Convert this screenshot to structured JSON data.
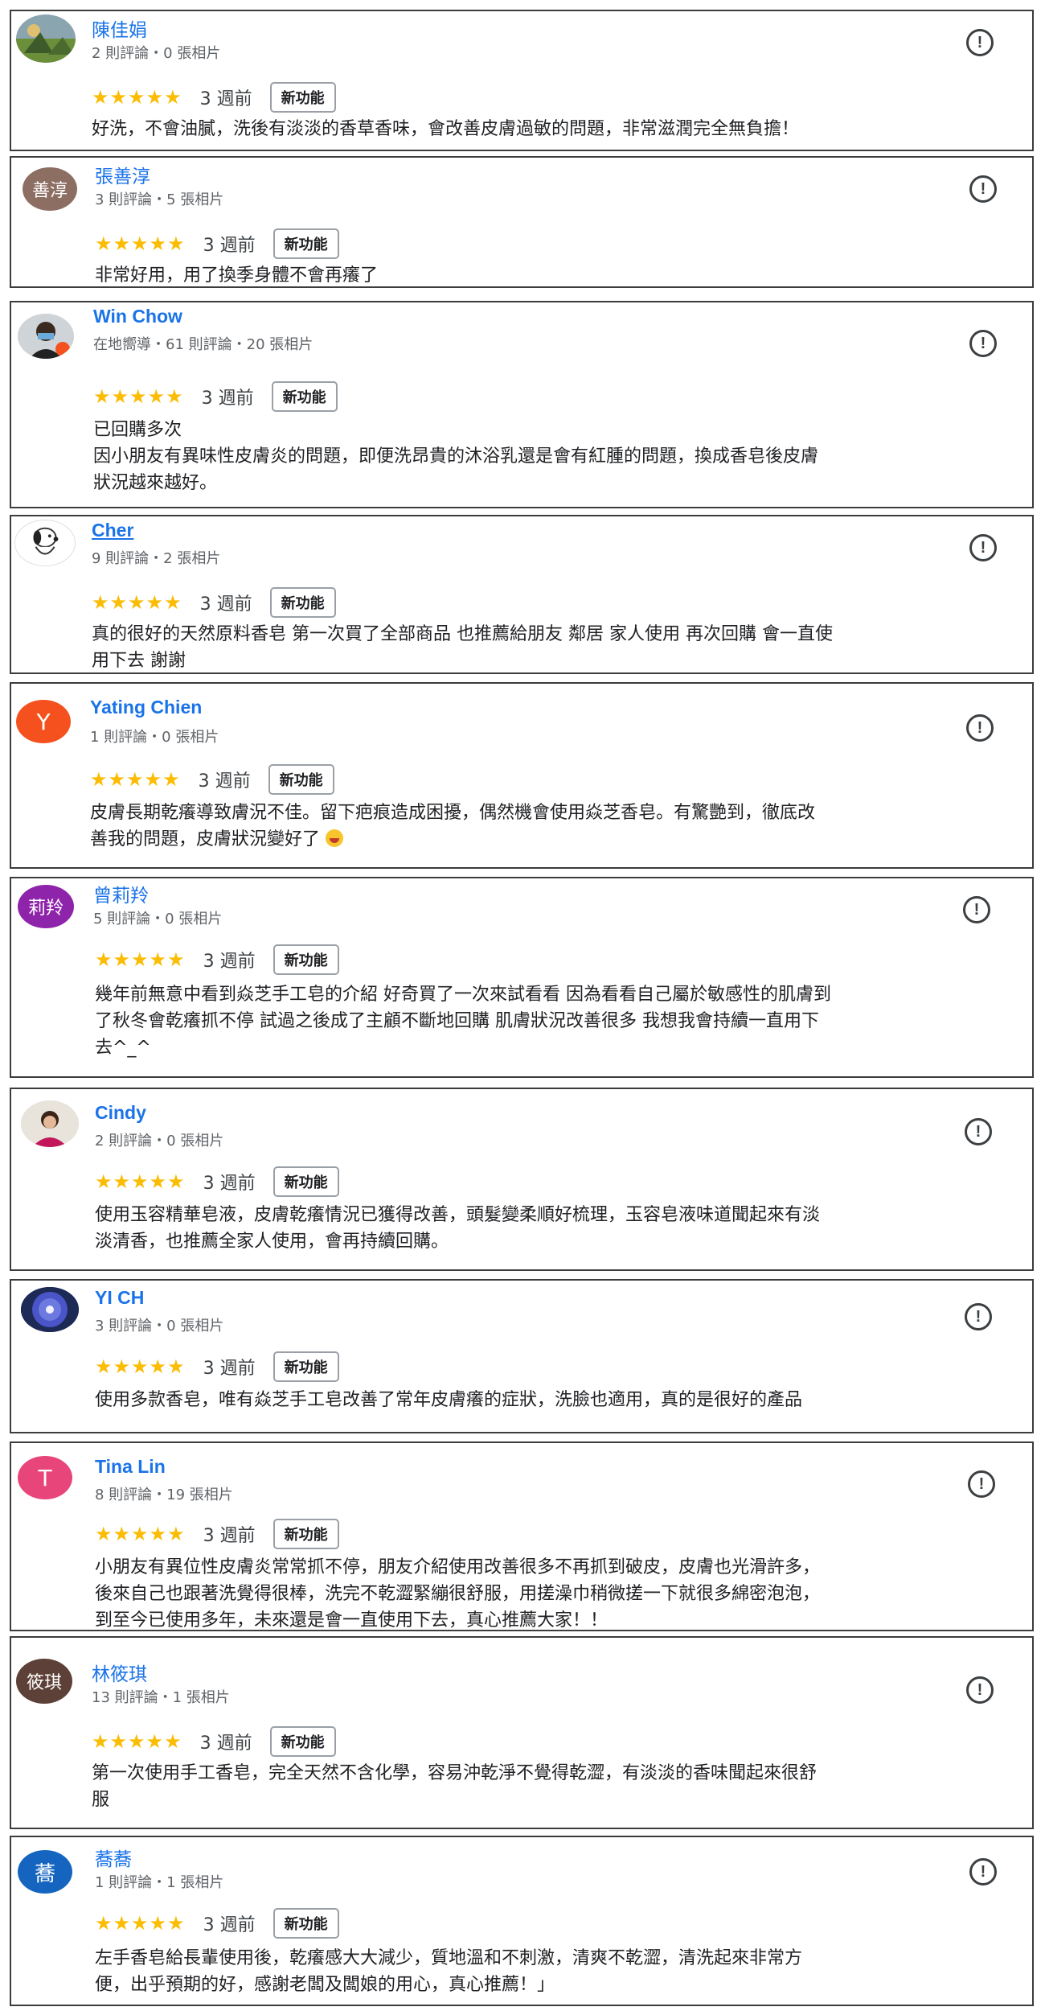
{
  "flag_glyph": "!",
  "badge_label": "新功能",
  "stars": "★★★★★",
  "reviews": [
    {
      "name": "陳佳娟",
      "meta": "2 則評論・0 張相片",
      "time": "3 週前",
      "text": "好洗，不會油膩，洗後有淡淡的香草香味，會改善皮膚過敏的問題，非常滋潤完全無負擔！",
      "avatar_text": "",
      "avatar_icon": "landscape-photo-icon"
    },
    {
      "name": "張善淳",
      "meta": "3 則評論・5 張相片",
      "time": "3 週前",
      "text": "非常好用，用了換季身體不會再癢了",
      "avatar_text": "善淳",
      "avatar_color": "#8d6e63"
    },
    {
      "name": "Win Chow",
      "meta": "在地嚮導・61 則評論・20 張相片",
      "time": "3 週前",
      "text": "已回購多次\n因小朋友有異味性皮膚炎的問題，即便洗昂貴的沐浴乳還是會有紅腫的問題，換成香皂後皮膚\n狀況越來越好。",
      "avatar_text": "",
      "avatar_icon": "person-photo-icon"
    },
    {
      "name": "Cher",
      "meta": "9 則評論・2 張相片",
      "time": "3 週前",
      "text": "真的很好的天然原料香皂 第一次買了全部商品 也推薦給朋友 鄰居 家人使用 再次回購 會一直使\n用下去 謝謝",
      "avatar_text": "",
      "avatar_icon": "snoopy-icon"
    },
    {
      "name": "Yating Chien",
      "meta": "1 則評論・0 張相片",
      "time": "3 週前",
      "text": "皮膚長期乾癢導致膚況不佳。留下疤痕造成困擾，偶然機會使用焱芝香皂。有驚艷到，徹底改\n善我的問題，皮膚狀況變好了",
      "avatar_text": "Y",
      "avatar_color": "#f4511e"
    },
    {
      "name": "曾莉羚",
      "meta": "5 則評論・0 張相片",
      "time": "3 週前",
      "text": "幾年前無意中看到焱芝手工皂的介紹 好奇買了一次來試看看 因為看看自己屬於敏感性的肌膚到\n了秋冬會乾癢抓不停 試過之後成了主顧不斷地回購 肌膚狀況改善很多 我想我會持續一直用下\n去^_^",
      "avatar_text": "莉羚",
      "avatar_color": "#8e24aa"
    },
    {
      "name": "Cindy",
      "meta": "2 則評論・0 張相片",
      "time": "3 週前",
      "text": "使用玉容精華皂液，皮膚乾癢情況已獲得改善，頭髮變柔順好梳理，玉容皂液味道聞起來有淡\n淡清香，也推薦全家人使用，會再持續回購。",
      "avatar_text": "",
      "avatar_icon": "person-photo-icon"
    },
    {
      "name": "YI CH",
      "meta": "3 則評論・0 張相片",
      "time": "3 週前",
      "text": "使用多款香皂，唯有焱芝手工皂改善了常年皮膚癢的症狀，洗臉也適用，真的是很好的產品",
      "avatar_text": "",
      "avatar_icon": "flower-photo-icon"
    },
    {
      "name": "Tina Lin",
      "meta": "8 則評論・19 張相片",
      "time": "3 週前",
      "text": "小朋友有異位性皮膚炎常常抓不停，朋友介紹使用改善很多不再抓到破皮，皮膚也光滑許多，\n後來自己也跟著洗覺得很棒，洗完不乾澀緊繃很舒服，用搓澡巾稍微搓一下就很多綿密泡泡，\n到至今已使用多年，未來還是會一直使用下去，真心推薦大家！！",
      "avatar_text": "T",
      "avatar_color": "#e8457a"
    },
    {
      "name": "林筱琪",
      "meta": "13 則評論・1 張相片",
      "time": "3 週前",
      "text": "第一次使用手工香皂，完全天然不含化學，容易沖乾淨不覺得乾澀，有淡淡的香味聞起來很舒\n服",
      "avatar_text": "筱琪",
      "avatar_color": "#5d4037"
    },
    {
      "name": "蕎蕎",
      "meta": "1 則評論・1 張相片",
      "time": "3 週前",
      "text": "左手香皂給長輩使用後，乾癢感大大減少，質地溫和不刺激，清爽不乾澀，清洗起來非常方\n便，出乎預期的好，感謝老闆及闆娘的用心，真心推薦！」",
      "avatar_text": "蕎",
      "avatar_color": "#1565c0"
    }
  ]
}
